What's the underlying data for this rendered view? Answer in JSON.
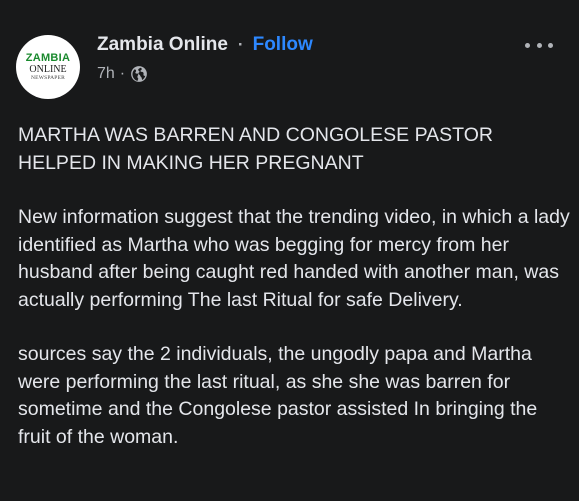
{
  "post": {
    "avatar": {
      "logo_line1": "ZAMBIA",
      "logo_line2": "ONLINE",
      "logo_line3": "NEWSPAPER"
    },
    "author": "Zambia Online",
    "separator": "·",
    "follow_label": "Follow",
    "time": "7h",
    "time_separator": "·",
    "privacy_icon": "globe-icon",
    "more_icon": "more-options-icon",
    "paragraphs": [
      "MARTHA WAS BARREN AND CONGOLESE PASTOR HELPED IN MAKING HER PREGNANT",
      "New information suggest that the trending video, in which a lady identified as Martha who was  begging for mercy from her husband after being caught red handed with another man, was actually performing The last Ritual for safe Delivery.",
      "sources say the 2 individuals, the ungodly papa and Martha were performing the last ritual, as she she was barren for sometime and the Congolese pastor assisted In bringing the fruit of the woman."
    ]
  },
  "colors": {
    "background": "#18191a",
    "text_primary": "#e4e6eb",
    "text_secondary": "#b0b3b8",
    "link": "#2d88ff",
    "logo_green": "#1a8a2e"
  }
}
